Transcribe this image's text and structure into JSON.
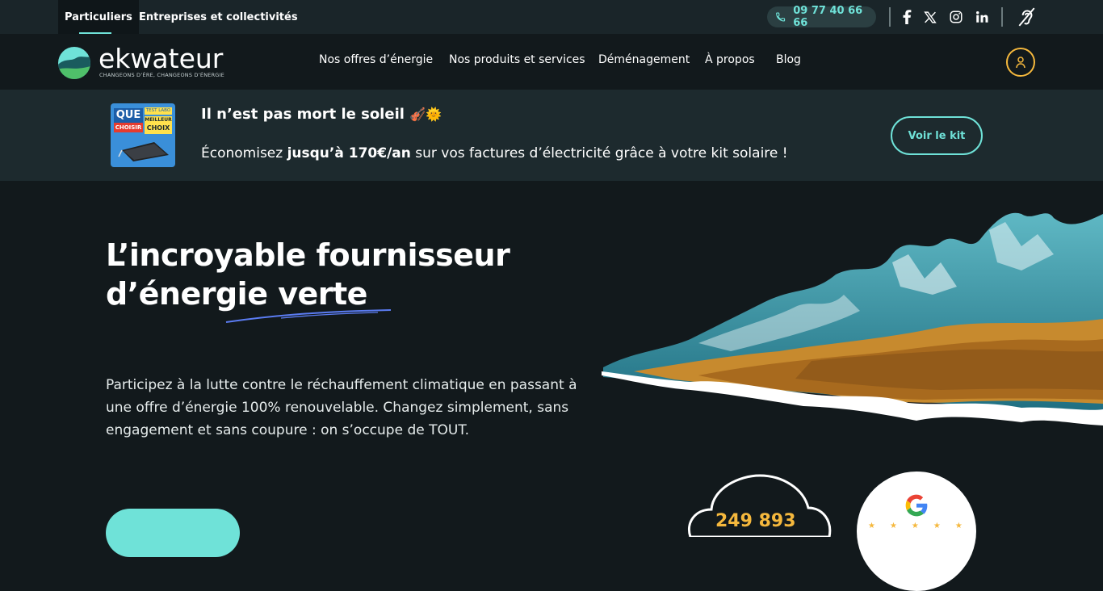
{
  "topbar": {
    "tabs": [
      {
        "label": "Particuliers",
        "active": true
      },
      {
        "label": "Entreprises et collectivités",
        "active": false
      }
    ],
    "phone": "09 77 40 66 66",
    "social": [
      "facebook-icon",
      "x-icon",
      "instagram-icon",
      "linkedin-icon"
    ],
    "accessibility_icon": "ear-accessibility-icon"
  },
  "nav": {
    "logo_text": "ekwateur",
    "logo_tagline": "CHANGEONS D’ÈRE, CHANGEONS D’ÉNERGIE",
    "items": [
      "Nos offres d’énergie",
      "Nos produits et services",
      "Déménagement",
      "À propos",
      "Blog"
    ],
    "account_icon": "user-icon"
  },
  "promo": {
    "badge_top": "QUE",
    "badge_bottom": "CHOISIR",
    "badge_lab": "TEST LABO",
    "badge_choice_1": "MEILLEUR",
    "badge_choice_2": "CHOIX",
    "title": "Il n’est pas mort le soleil",
    "title_emoji": "🎻🌞",
    "text_before": "Économisez ",
    "text_bold": "jusqu’à 170€/an",
    "text_after": " sur vos factures d’électricité grâce à votre kit solaire !",
    "button": "Voir le kit"
  },
  "hero": {
    "title_line1": "L’incroyable fournisseur",
    "title_line2": "d’énergie verte",
    "description": "Participez à la lutte contre le réchauffement climatique en passant à une offre d’énergie 100% renouvelable. Changez simplement, sans engagement et sans coupure : on s’occupe de TOUT.",
    "counter": "249 893",
    "google_stars": "★★★★★"
  },
  "colors": {
    "accent": "#6fe2d8",
    "warning": "#f5b83d",
    "background": "#12191c"
  }
}
